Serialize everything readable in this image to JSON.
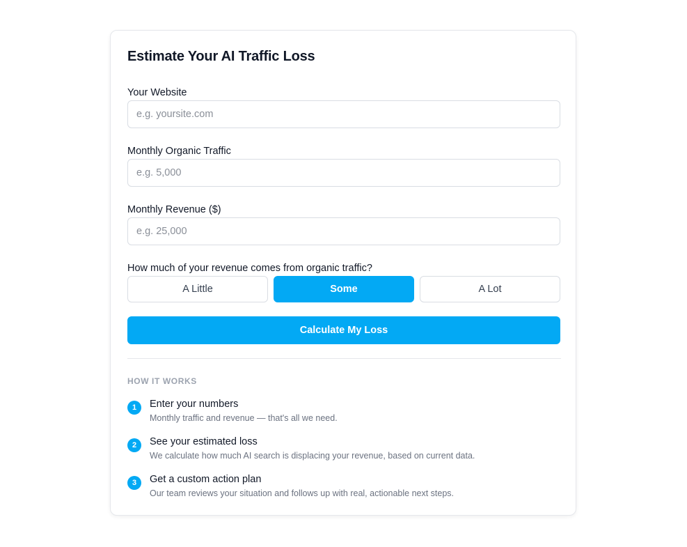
{
  "form": {
    "title": "Estimate Your AI Traffic Loss",
    "website_label": "Your Website",
    "website_value": "",
    "website_placeholder": "e.g. yoursite.com",
    "traffic_label": "Monthly Organic Traffic",
    "traffic_value": "",
    "traffic_placeholder": "e.g. 5,000",
    "revenue_label": "Monthly Revenue ($)",
    "revenue_value": "",
    "revenue_placeholder": "e.g. 25,000",
    "share_question": "How much of your revenue comes from organic traffic?",
    "share_options": [
      {
        "label": "A Little",
        "selected": false
      },
      {
        "label": "Some",
        "selected": true
      },
      {
        "label": "A Lot",
        "selected": false
      }
    ],
    "submit_label": "Calculate My Loss"
  },
  "how_it_works": {
    "heading": "HOW IT WORKS",
    "steps": [
      {
        "number": "1",
        "title": "Enter your numbers",
        "description": "Monthly traffic and revenue — that's all we need."
      },
      {
        "number": "2",
        "title": "See your estimated loss",
        "description": "We calculate how much AI search is displacing your revenue, based on current data."
      },
      {
        "number": "3",
        "title": "Get a custom action plan",
        "description": "Our team reviews your situation and follows up with real, actionable next steps."
      }
    ]
  },
  "colors": {
    "accent": "#03a9f4",
    "border": "#d9dde3",
    "muted_text": "#6b7280"
  }
}
